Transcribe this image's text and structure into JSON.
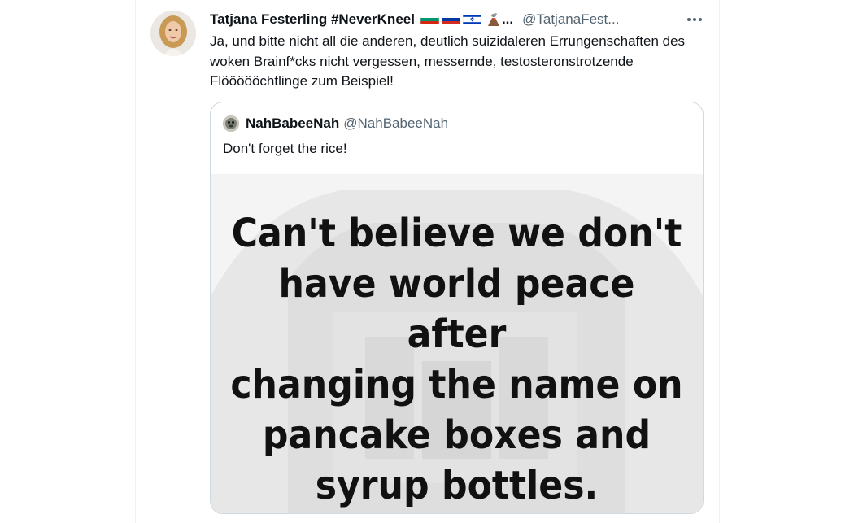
{
  "tweet": {
    "author_name": "Tatjana Festerling #NeverKneel",
    "name_ellipsis": "...",
    "handle": "@TatjanaFest...",
    "text": "Ja, und bitte nicht all die anderen, deutlich suizidaleren Errungenschaften des woken Brainf*cks nicht vergessen, messernde, testosteronstrotzende Flöööööchtlinge zum Beispiel!",
    "flag_icons": [
      "bulgaria-flag-icon",
      "russia-flag-icon",
      "israel-flag-icon"
    ],
    "extra_icon": "volcano-icon",
    "more_icon": "more-horizontal-icon"
  },
  "quote": {
    "author_name": "NahBabeeNah",
    "handle": "@NahBabeeNah",
    "text": "Don't forget the rice!",
    "media": {
      "meme_text": "Can't believe we don't have world peace after changing the name on pancake boxes and syrup bottles.",
      "meme_lines": [
        "Can't believe we don't",
        "have world peace after",
        "changing the name on",
        "pancake boxes and",
        "syrup bottles."
      ]
    }
  },
  "colors": {
    "primary_text": "#0f1419",
    "secondary_text": "#536471",
    "border": "#cfd9de"
  }
}
